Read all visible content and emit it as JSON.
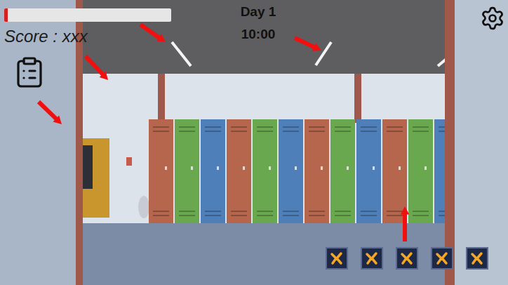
{
  "hud": {
    "health": {
      "level": 0.02
    },
    "score": "Score : xxx",
    "day": "Day 1",
    "time": "10:00"
  },
  "inventory": [
    {
      "filled": false
    },
    {
      "filled": false
    },
    {
      "filled": false
    },
    {
      "filled": false
    },
    {
      "filled": false
    }
  ]
}
